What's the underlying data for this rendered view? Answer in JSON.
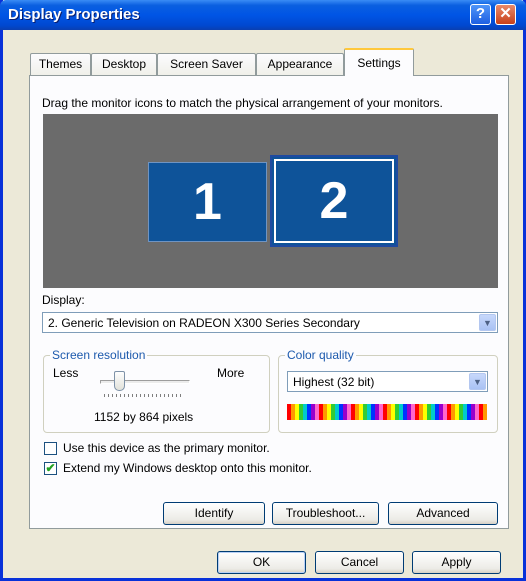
{
  "window": {
    "title": "Display Properties",
    "help_glyph": "?",
    "close_glyph": "✕"
  },
  "tabs": [
    "Themes",
    "Desktop",
    "Screen Saver",
    "Appearance",
    "Settings"
  ],
  "instruction": "Drag the monitor icons to match the physical arrangement of your monitors.",
  "monitors": [
    "1",
    "2"
  ],
  "display": {
    "label": "Display:",
    "value": "2. Generic Television on RADEON X300 Series Secondary",
    "arrow": "▼"
  },
  "resolution": {
    "title": "Screen resolution",
    "less": "Less",
    "more": "More",
    "value_text": "1152 by 864 pixels",
    "slider_fraction": 0.2
  },
  "color_quality": {
    "title": "Color quality",
    "value": "Highest (32 bit)",
    "arrow": "▼"
  },
  "options": {
    "primary_label": "Use this device as the primary monitor.",
    "primary_checked": false,
    "extend_label": "Extend my Windows desktop onto this monitor.",
    "extend_checked": true,
    "check_glyph": "✔"
  },
  "buttons": {
    "identify": "Identify",
    "troubleshoot": "Troubleshoot...",
    "advanced": "Advanced",
    "ok": "OK",
    "cancel": "Cancel",
    "apply": "Apply"
  },
  "colors": {
    "title_bar": "#0055e5",
    "monitor_fill": "#0e5399",
    "preview_bg": "#6b6b6b",
    "group_title": "#1d5aad"
  }
}
